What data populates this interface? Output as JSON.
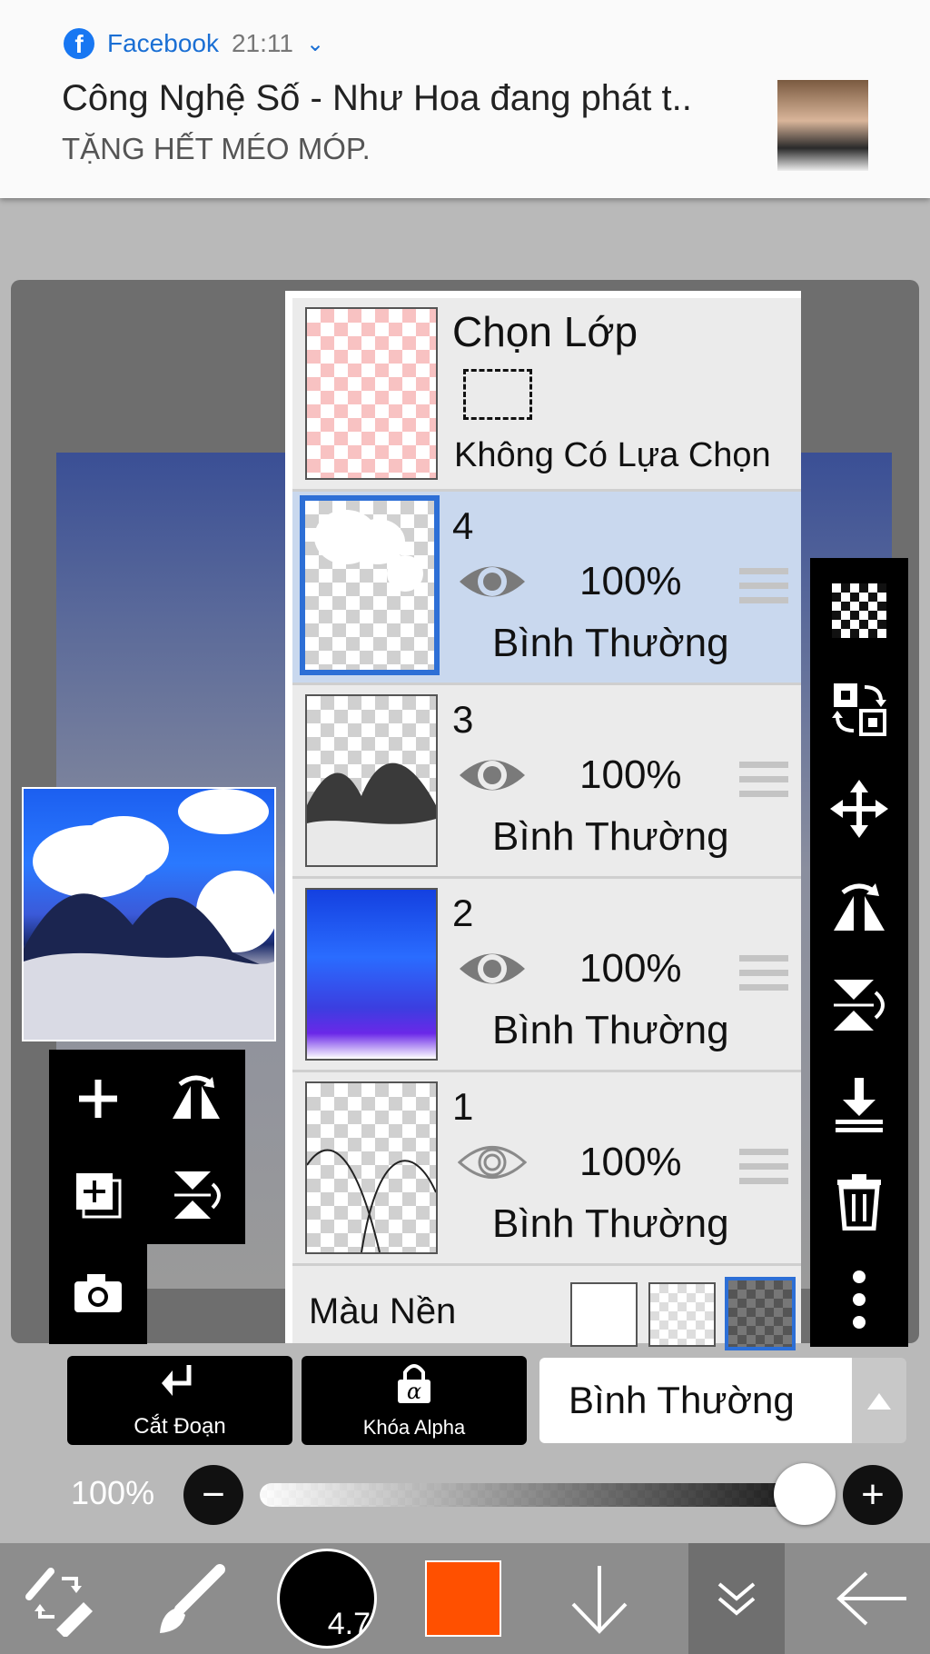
{
  "notification": {
    "app_name": "Facebook",
    "time": "21:11",
    "title": "Công Nghệ Số - Như Hoa đang phát t..",
    "body": "TẶNG HẾT MÉO MÓP."
  },
  "layer_panel": {
    "selection": {
      "title": "Chọn Lớp",
      "status": "Không Có Lựa Chọn"
    },
    "layers": [
      {
        "number": "4",
        "opacity": "100%",
        "blend": "Bình Thường",
        "visible": true,
        "selected": true
      },
      {
        "number": "3",
        "opacity": "100%",
        "blend": "Bình Thường",
        "visible": true,
        "selected": false
      },
      {
        "number": "2",
        "opacity": "100%",
        "blend": "Bình Thường",
        "visible": true,
        "selected": false
      },
      {
        "number": "1",
        "opacity": "100%",
        "blend": "Bình Thường",
        "visible": false,
        "selected": false
      }
    ],
    "background_label": "Màu Nền"
  },
  "bottom_controls": {
    "clipping_label": "Cắt Đoạn",
    "alpha_lock_label": "Khóa Alpha",
    "blend_mode": "Bình Thường",
    "opacity_label": "100%",
    "opacity_value": 1.0
  },
  "bottom_nav": {
    "brush_size": "4.7",
    "color": "#ff5000"
  },
  "colors": {
    "selected_row": "#c9d8ee",
    "selected_border": "#2d6fd6",
    "facebook_blue": "#1877f2"
  }
}
